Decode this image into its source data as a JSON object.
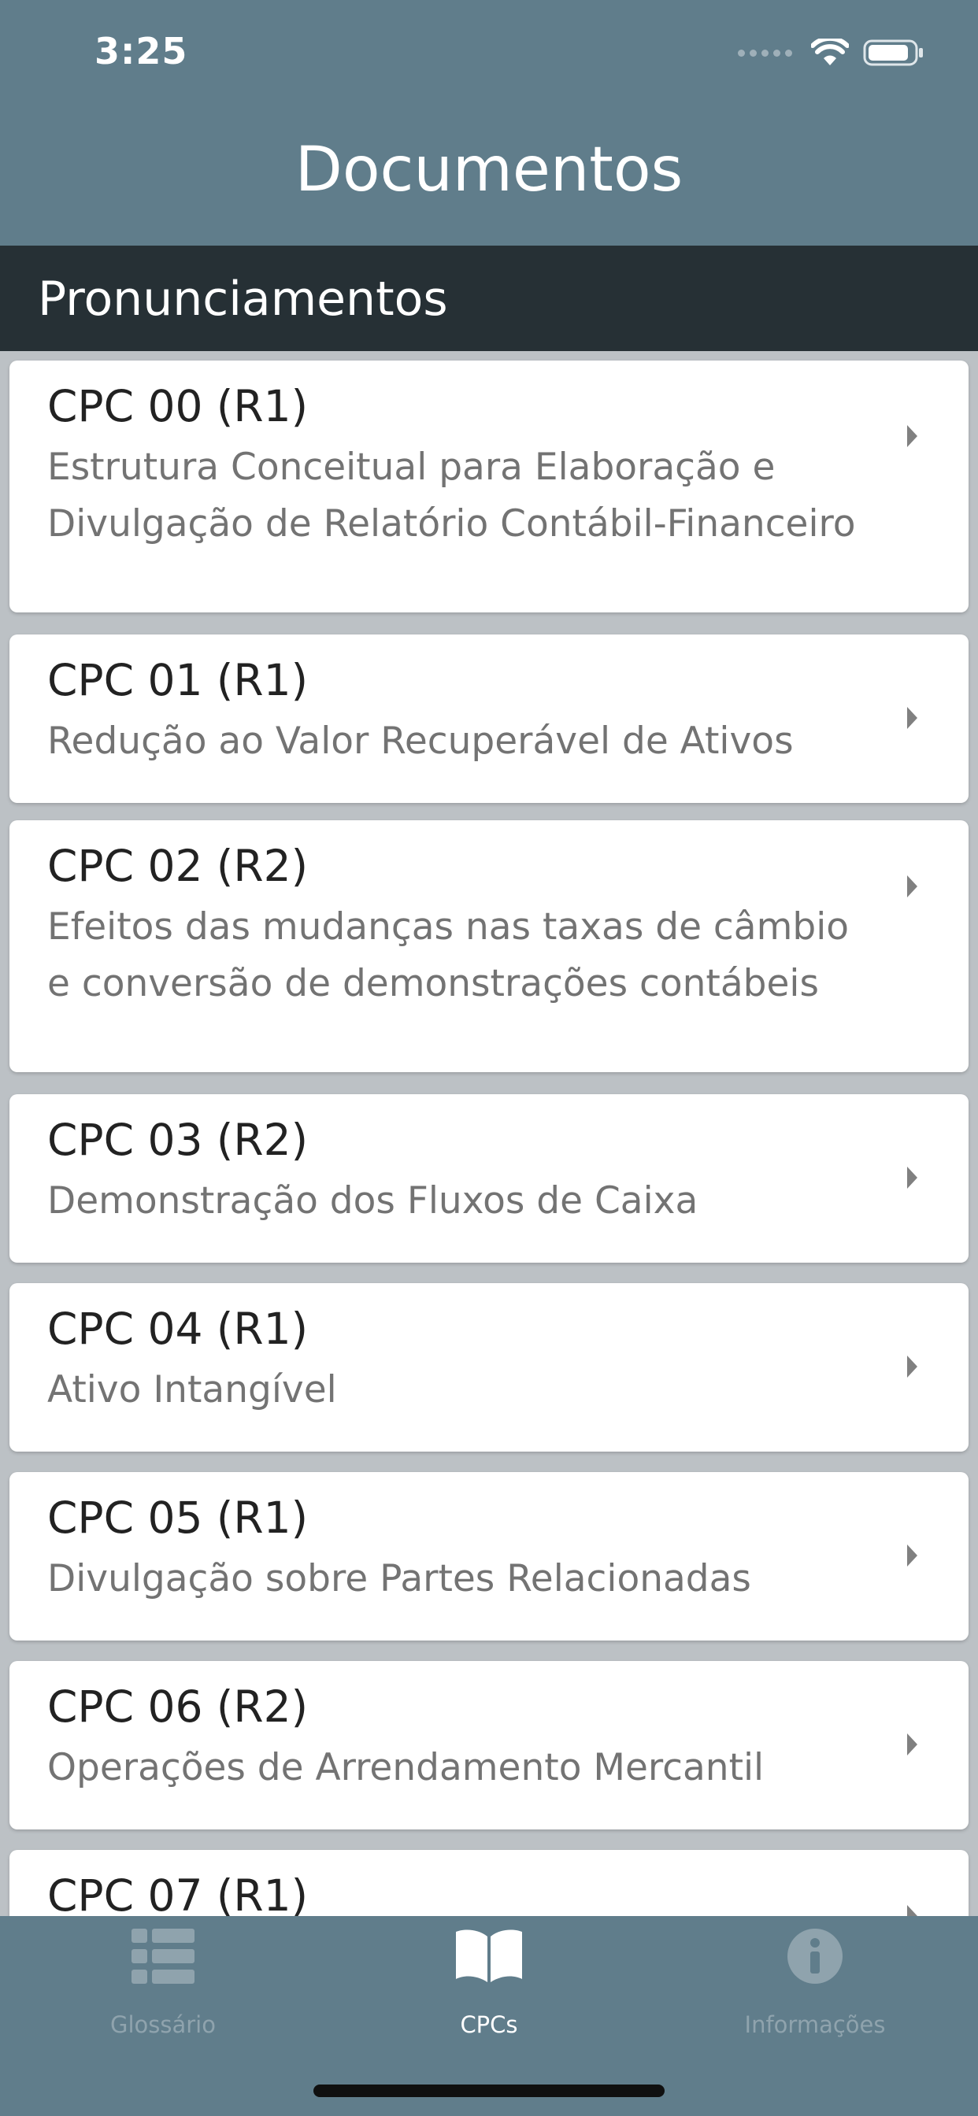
{
  "status_bar": {
    "time": "3:25",
    "icons": [
      "signal-dots-icon",
      "wifi-icon",
      "battery-icon"
    ]
  },
  "header": {
    "title": "Documentos"
  },
  "section": {
    "title": "Pronunciamentos"
  },
  "items": [
    {
      "title": "CPC 00 (R1)",
      "subtitle": "Estrutura Conceitual para Elaboração e Divulgação de Relatório Contábil-Financeiro"
    },
    {
      "title": "CPC 01 (R1)",
      "subtitle": "Redução ao Valor Recuperável de Ativos"
    },
    {
      "title": "CPC 02 (R2)",
      "subtitle": "Efeitos das mudanças nas taxas de câmbio e conversão de demonstrações contábeis"
    },
    {
      "title": "CPC 03 (R2)",
      "subtitle": "Demonstração dos Fluxos de Caixa"
    },
    {
      "title": "CPC 04 (R1)",
      "subtitle": "Ativo Intangível"
    },
    {
      "title": "CPC 05 (R1)",
      "subtitle": "Divulgação sobre Partes Relacionadas"
    },
    {
      "title": "CPC 06 (R2)",
      "subtitle": "Operações de Arrendamento Mercantil"
    },
    {
      "title": "CPC 07 (R1)",
      "subtitle": ""
    }
  ],
  "tabbar": {
    "tabs": [
      {
        "label": "Glossário",
        "icon": "list-icon",
        "active": false
      },
      {
        "label": "CPCs",
        "icon": "book-icon",
        "active": true
      },
      {
        "label": "Informações",
        "icon": "info-icon",
        "active": false
      }
    ]
  },
  "colors": {
    "header_bg": "#607d8b",
    "section_bg": "#263035",
    "list_bg": "#bcc1c5",
    "card_bg": "#ffffff",
    "title_text": "#222222",
    "subtitle_text": "#737373",
    "tab_active": "#ffffff",
    "tab_inactive": "#8fa3ad"
  }
}
